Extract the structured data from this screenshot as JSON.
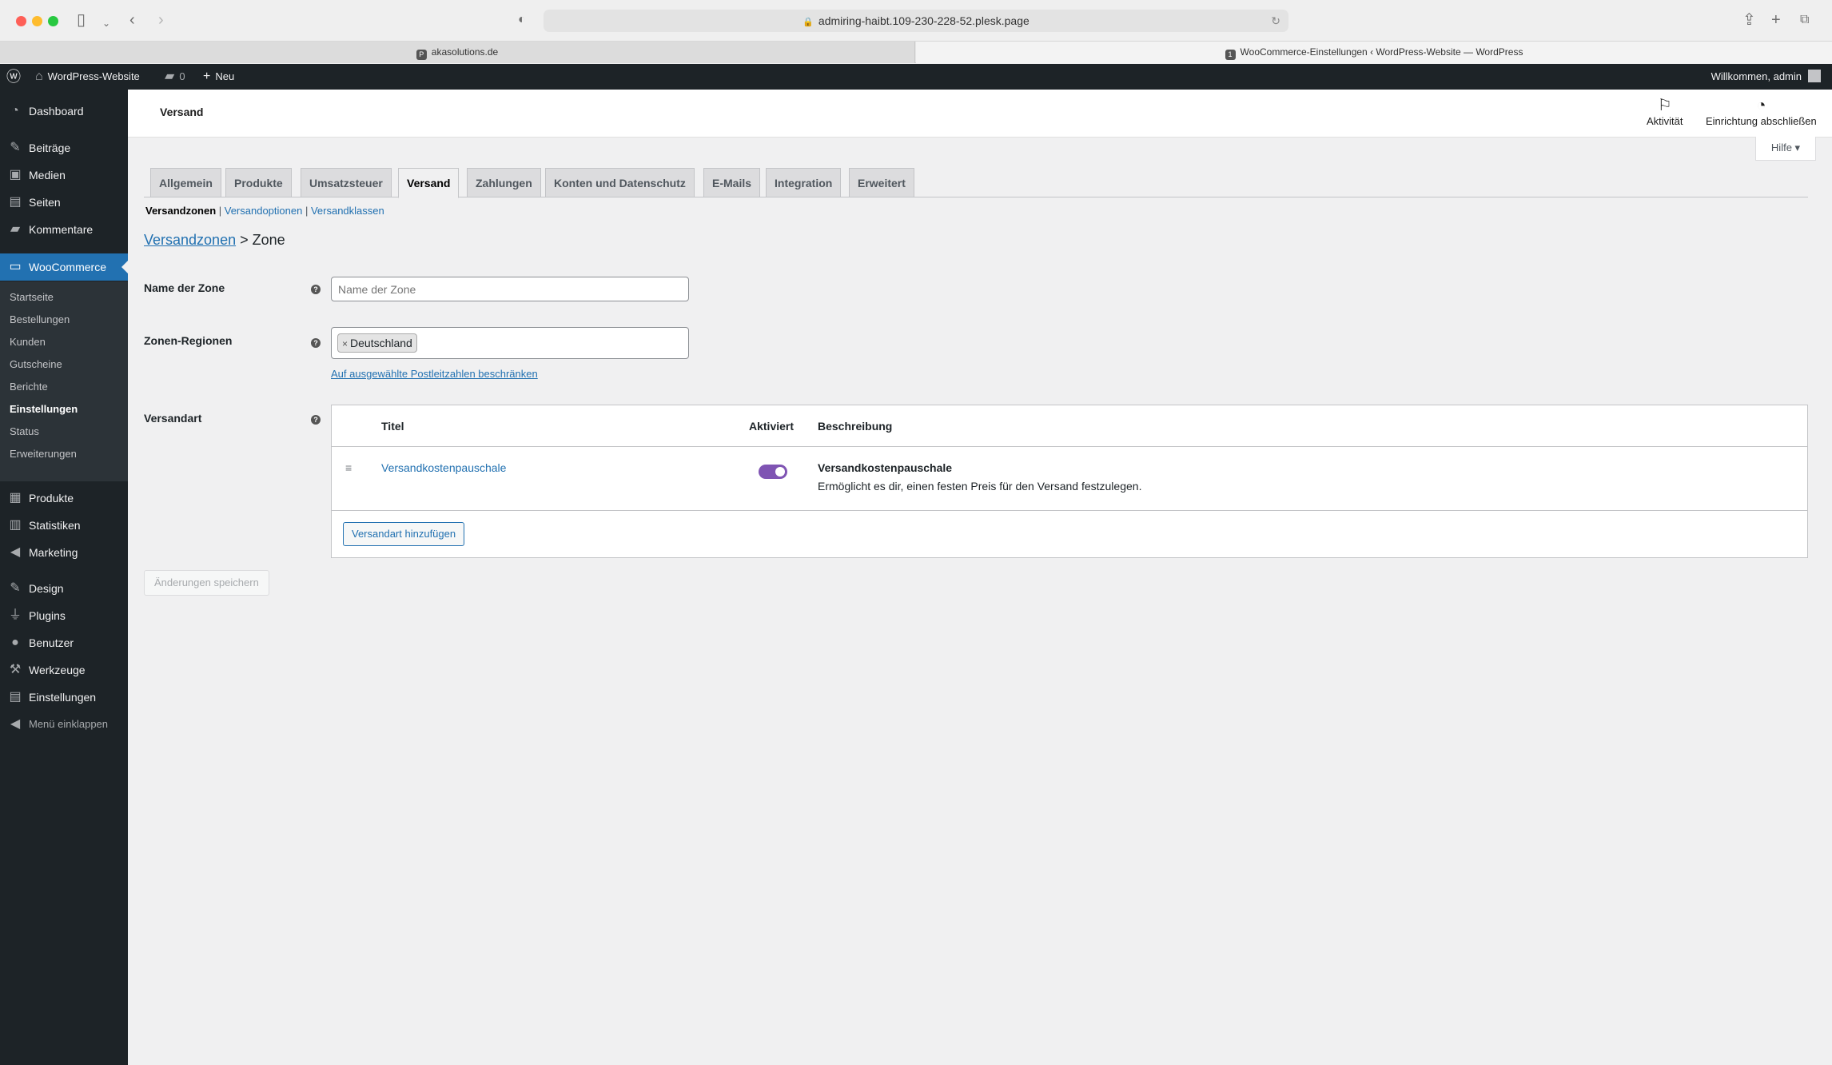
{
  "browser": {
    "url": "admiring-haibt.109-230-228-52.plesk.page",
    "tabs": [
      {
        "label": "akasolutions.de"
      },
      {
        "label": "WooCommerce-Einstellungen ‹ WordPress-Website — WordPress"
      }
    ]
  },
  "adminbar": {
    "site_name": "WordPress-Website",
    "comments_count": "0",
    "new_label": "Neu",
    "greeting": "Willkommen, admin"
  },
  "sidebar": {
    "items": [
      {
        "label": "Dashboard",
        "icon": "dashboard-icon"
      },
      {
        "label": "Beiträge",
        "icon": "pin-icon"
      },
      {
        "label": "Medien",
        "icon": "media-icon"
      },
      {
        "label": "Seiten",
        "icon": "page-icon"
      },
      {
        "label": "Kommentare",
        "icon": "comment-icon"
      },
      {
        "label": "WooCommerce",
        "icon": "woo-icon"
      },
      {
        "label": "Produkte",
        "icon": "archive-icon"
      },
      {
        "label": "Statistiken",
        "icon": "chart-icon"
      },
      {
        "label": "Marketing",
        "icon": "megaphone-icon"
      },
      {
        "label": "Design",
        "icon": "brush-icon"
      },
      {
        "label": "Plugins",
        "icon": "plugin-icon"
      },
      {
        "label": "Benutzer",
        "icon": "user-icon"
      },
      {
        "label": "Werkzeuge",
        "icon": "wrench-icon"
      },
      {
        "label": "Einstellungen",
        "icon": "settings-icon"
      }
    ],
    "woo_sub": [
      {
        "label": "Startseite"
      },
      {
        "label": "Bestellungen"
      },
      {
        "label": "Kunden"
      },
      {
        "label": "Gutscheine"
      },
      {
        "label": "Berichte"
      },
      {
        "label": "Einstellungen"
      },
      {
        "label": "Status"
      },
      {
        "label": "Erweiterungen"
      }
    ],
    "collapse_label": "Menü einklappen"
  },
  "header": {
    "title": "Versand",
    "activity_label": "Aktivität",
    "setup_label": "Einrichtung abschließen",
    "help_label": "Hilfe ▾"
  },
  "nav_tabs": [
    {
      "label": "Allgemein"
    },
    {
      "label": "Produkte"
    },
    {
      "label": "Umsatzsteuer"
    },
    {
      "label": "Versand"
    },
    {
      "label": "Zahlungen"
    },
    {
      "label": "Konten und Datenschutz"
    },
    {
      "label": "E-Mails"
    },
    {
      "label": "Integration"
    },
    {
      "label": "Erweitert"
    }
  ],
  "subnav": {
    "zones": "Versandzonen",
    "options": "Versandoptionen",
    "classes": "Versandklassen"
  },
  "breadcrumb": {
    "link": "Versandzonen",
    "current": "> Zone"
  },
  "form": {
    "zone_name_label": "Name der Zone",
    "zone_name_placeholder": "Name der Zone",
    "regions_label": "Zonen-Regionen",
    "region_chip": "Deutschland",
    "postcode_link": "Auf ausgewählte Postleitzahlen beschränken",
    "method_label": "Versandart"
  },
  "methods_table": {
    "col_title": "Titel",
    "col_enabled": "Aktiviert",
    "col_description": "Beschreibung",
    "rows": [
      {
        "title": "Versandkostenpauschale",
        "enabled": true,
        "desc_title": "Versandkostenpauschale",
        "desc_text": "Ermöglicht es dir, einen festen Preis für den Versand festzulegen."
      }
    ],
    "add_button": "Versandart hinzufügen"
  },
  "save_button": "Änderungen speichern",
  "colors": {
    "admin_dark": "#1d2327",
    "wp_blue": "#2271b1",
    "woo_purple": "#7f54b3"
  }
}
